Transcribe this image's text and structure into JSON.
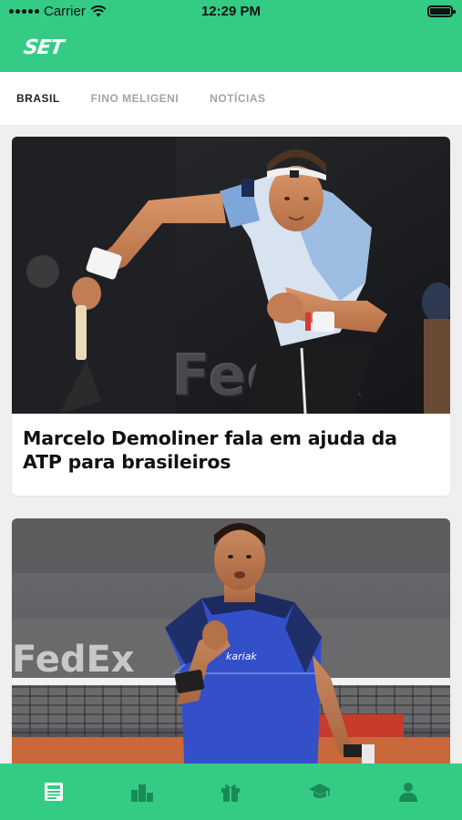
{
  "status_bar": {
    "carrier": "Carrier",
    "time": "12:29 PM"
  },
  "app": {
    "logo": "SET",
    "brand_color": "#34cc85"
  },
  "tabs": [
    {
      "label": "BRASIL",
      "active": true
    },
    {
      "label": "FINO MELIGENI",
      "active": false
    },
    {
      "label": "NOTÍCIAS",
      "active": false
    }
  ],
  "feed": {
    "articles": [
      {
        "headline": "Marcelo Demoliner fala em ajuda da ATP para brasileiros"
      },
      {
        "headline": ""
      }
    ]
  },
  "tab_bar": {
    "items": [
      {
        "icon": "news-icon",
        "active": true
      },
      {
        "icon": "ranking-icon",
        "active": false
      },
      {
        "icon": "gift-icon",
        "active": false
      },
      {
        "icon": "graduation-cap-icon",
        "active": false
      },
      {
        "icon": "user-icon",
        "active": false
      }
    ]
  }
}
